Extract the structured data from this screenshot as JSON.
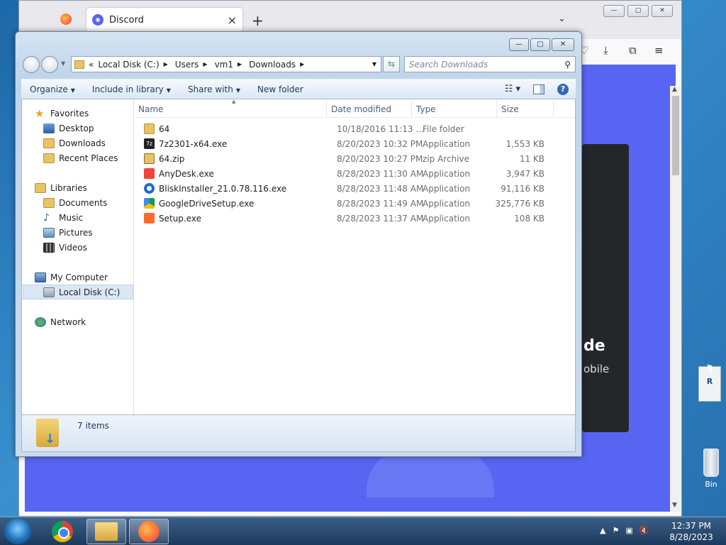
{
  "browser": {
    "tab_title": "Discord",
    "new_tab": "+",
    "tab_close": "×",
    "page_heading_fragment": "de",
    "page_sub_fragment": "obile"
  },
  "explorer": {
    "address": {
      "overflow": "«",
      "crumbs": [
        "Local Disk (C:)",
        "Users",
        "vm1",
        "Downloads"
      ]
    },
    "search_placeholder": "Search Downloads",
    "toolbar": {
      "organize": "Organize",
      "include_in_library": "Include in library",
      "share_with": "Share with",
      "new_folder": "New folder"
    },
    "nav": {
      "favorites": "Favorites",
      "desktop": "Desktop",
      "downloads": "Downloads",
      "recent_places": "Recent Places",
      "libraries": "Libraries",
      "documents": "Documents",
      "music": "Music",
      "pictures": "Pictures",
      "videos": "Videos",
      "my_computer": "My Computer",
      "local_disk": "Local Disk (C:)",
      "network": "Network"
    },
    "columns": {
      "name": "Name",
      "date_modified": "Date modified",
      "type": "Type",
      "size": "Size"
    },
    "files": [
      {
        "name": "64",
        "date": "10/18/2016 11:13 ...",
        "type": "File folder",
        "size": ""
      },
      {
        "name": "7z2301-x64.exe",
        "date": "8/20/2023 10:32 PM",
        "type": "Application",
        "size": "1,553 KB"
      },
      {
        "name": "64.zip",
        "date": "8/20/2023 10:27 PM",
        "type": "zip Archive",
        "size": "11 KB"
      },
      {
        "name": "AnyDesk.exe",
        "date": "8/28/2023 11:30 AM",
        "type": "Application",
        "size": "3,947 KB"
      },
      {
        "name": "BliskInstaller_21.0.78.116.exe",
        "date": "8/28/2023 11:48 AM",
        "type": "Application",
        "size": "91,116 KB"
      },
      {
        "name": "GoogleDriveSetup.exe",
        "date": "8/28/2023 11:49 AM",
        "type": "Application",
        "size": "325,776 KB"
      },
      {
        "name": "Setup.exe",
        "date": "8/28/2023 11:37 AM",
        "type": "Application",
        "size": "108 KB"
      }
    ],
    "status": "7 items"
  },
  "desktop": {
    "bin_label": "Bin"
  },
  "taskbar": {
    "time": "12:37 PM",
    "date": "8/28/2023"
  }
}
